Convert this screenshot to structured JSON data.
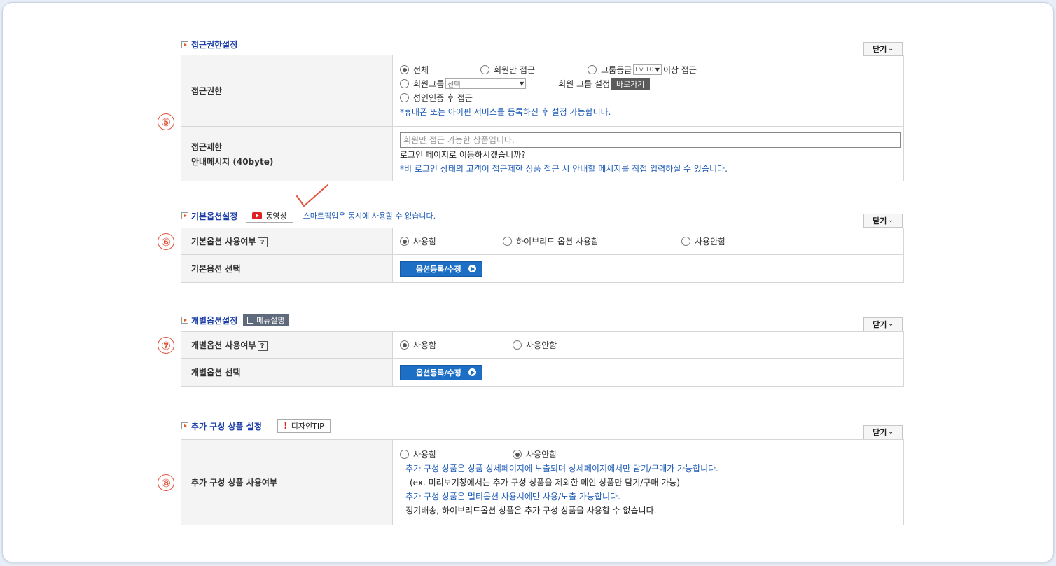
{
  "close_label": "닫기",
  "access": {
    "title": "접근권한설정",
    "row1_label": "접근권한",
    "opt_all": "전체",
    "opt_members": "회원만 접근",
    "opt_grade": "그룹등급",
    "grade_select": "Lv.10",
    "grade_suffix": "이상 접근",
    "opt_group": "회원그룹",
    "group_select": "선택",
    "group_setting": "회원 그룹 설정",
    "goto_label": "바로가기",
    "opt_adult": "성인인증 후 접근",
    "adult_note": "*휴대폰 또는 아이핀 서비스를 등록하신 후 설정 가능합니다.",
    "row2_label_1": "접근제한",
    "row2_label_2": "안내메시지 (40byte)",
    "message_placeholder": "회원만 접근 가능한 상품입니다.",
    "message_line2": "로그인 페이지로 이동하시겠습니까?",
    "message_note": "*비 로그인 상태의 고객이 접근제한 상품 접근 시 안내할 메시지를 직접 입력하실 수 있습니다."
  },
  "basic_option": {
    "title": "기본옵션설정",
    "video_label": "동영상",
    "note": "스마트픽업은 동시에 사용할 수 없습니다.",
    "row1_label": "기본옵션 사용여부",
    "help": "?",
    "opt_use": "사용함",
    "opt_hybrid": "하이브리드 옵션 사용함",
    "opt_unused": "사용안함",
    "row2_label": "기본옵션 선택",
    "register_label": "옵션등록/수정"
  },
  "individual_option": {
    "title": "개별옵션설정",
    "menu_desc": "메뉴설명",
    "row1_label": "개별옵션 사용여부",
    "help": "?",
    "opt_use": "사용함",
    "opt_unused": "사용안함",
    "row2_label": "개별옵션 선택",
    "register_label": "옵션등록/수정"
  },
  "additional": {
    "title": "추가 구성 상품 설정",
    "design_tip": "디자인TIP",
    "row_label": "추가 구성 상품 사용여부",
    "opt_use": "사용함",
    "opt_unused": "사용안함",
    "note1": "- 추가 구성 상품은 상품 상세페이지에 노출되며 상세페이지에서만 담기/구매가 가능합니다.",
    "note2": "(ex. 미리보기창에서는 추가 구성 상품을 제외한 메인 상품만 담기/구매 가능)",
    "note3": "- 추가 구성 상품은 멀티옵션 사용시에만 사용/노출 가능합니다.",
    "note4": "- 정기배송, 하이브리드옵션 상품은 추가 구성 상품을 사용할 수 없습니다."
  },
  "markers": [
    "⑤",
    "⑥",
    "⑦",
    "⑧"
  ],
  "colors": {
    "accent_blue": "#1e40a8",
    "note_blue": "#1e5bb5",
    "marker_red": "#e0533d",
    "button_blue": "#1d6fc5"
  }
}
